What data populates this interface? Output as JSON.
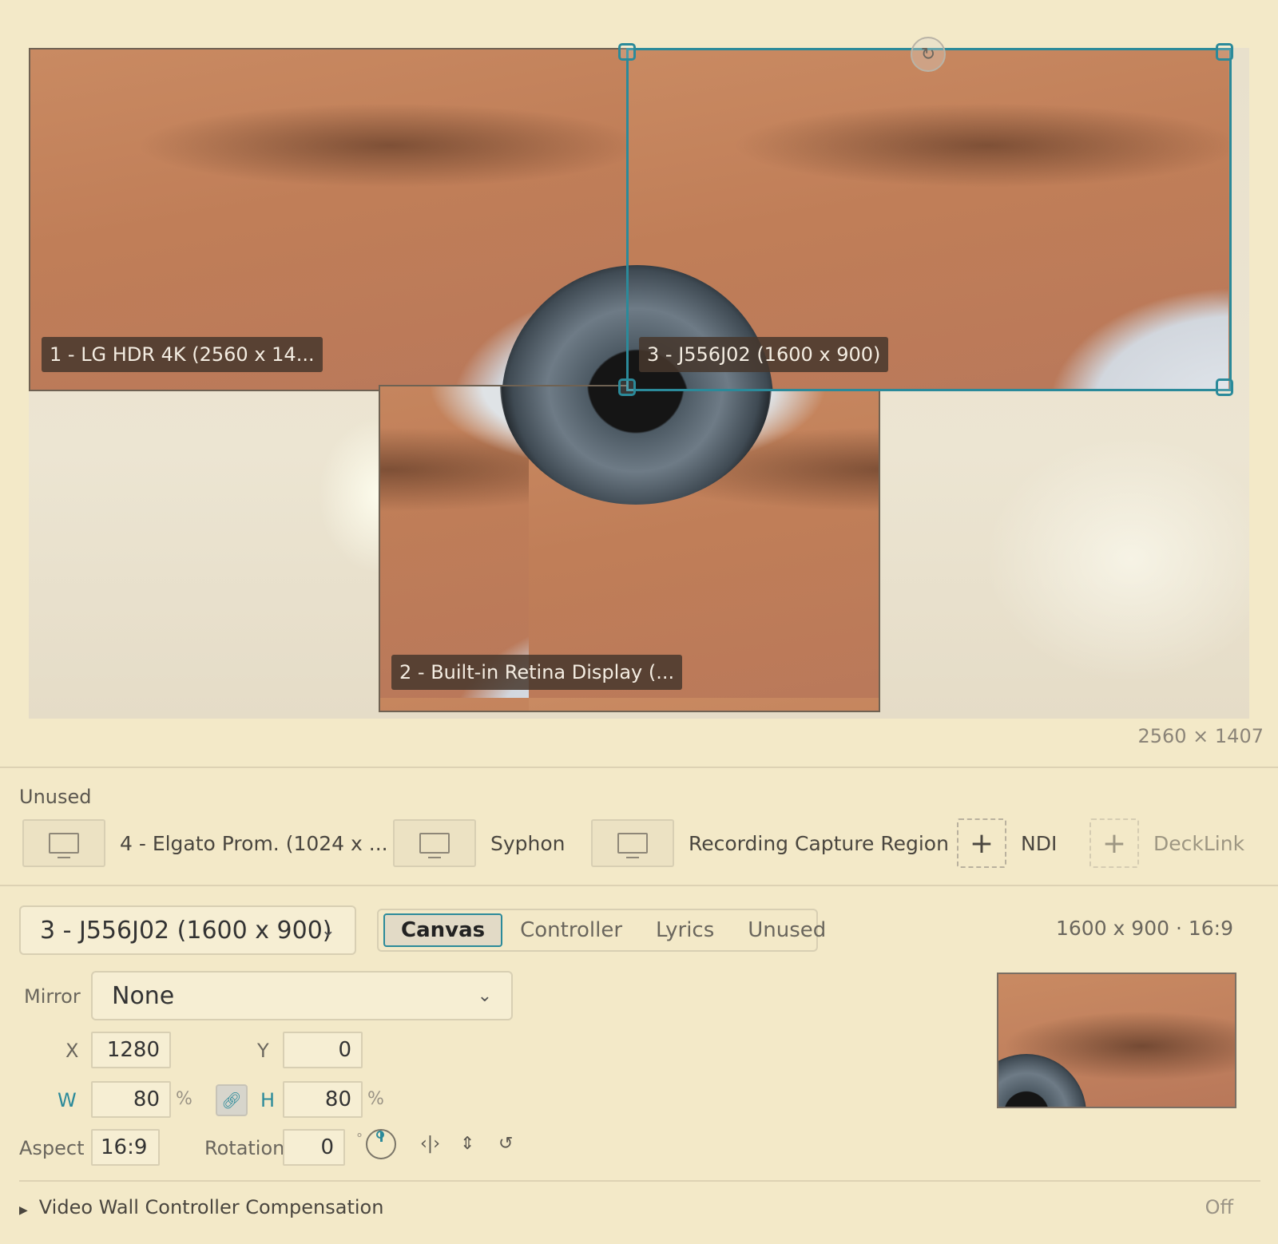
{
  "canvas": {
    "size_label": "2560 × 1407",
    "displays": [
      {
        "label": "1 - LG HDR 4K (2560 x 14..."
      },
      {
        "label": "2 - Built-in Retina Display (..."
      },
      {
        "label": "3 - J556J02 (1600 x 900)"
      }
    ]
  },
  "unused": {
    "title": "Unused",
    "items": [
      {
        "label": "4 - Elgato Prom. (1024 x ...",
        "icon": "monitor-icon"
      },
      {
        "label": "Syphon",
        "icon": "monitor-icon"
      },
      {
        "label": "Recording Capture Region",
        "icon": "monitor-icon"
      },
      {
        "label": "NDI",
        "icon": "plus-icon"
      },
      {
        "label": "DeckLink",
        "icon": "plus-icon"
      }
    ]
  },
  "controls": {
    "display_select": "3 - J556J02 (1600 x 900)",
    "tabs": [
      "Canvas",
      "Controller",
      "Lyrics",
      "Unused"
    ],
    "active_tab": "Canvas",
    "dims": "1600 x 900 · 16:9",
    "mirror_label": "Mirror",
    "mirror_value": "None",
    "x_label": "X",
    "x_value": "1280",
    "y_label": "Y",
    "y_value": "0",
    "w_label": "W",
    "w_value": "80",
    "h_label": "H",
    "h_value": "80",
    "percent": "%",
    "aspect_label": "Aspect",
    "aspect_value": "16:9",
    "rotation_label": "Rotation",
    "rotation_value": "0",
    "degree": "°",
    "video_wall_label": "Video Wall Controller Compensation",
    "video_wall_value": "Off"
  },
  "colors": {
    "accent": "#2b8a9a",
    "background": "#f3e9c8"
  }
}
